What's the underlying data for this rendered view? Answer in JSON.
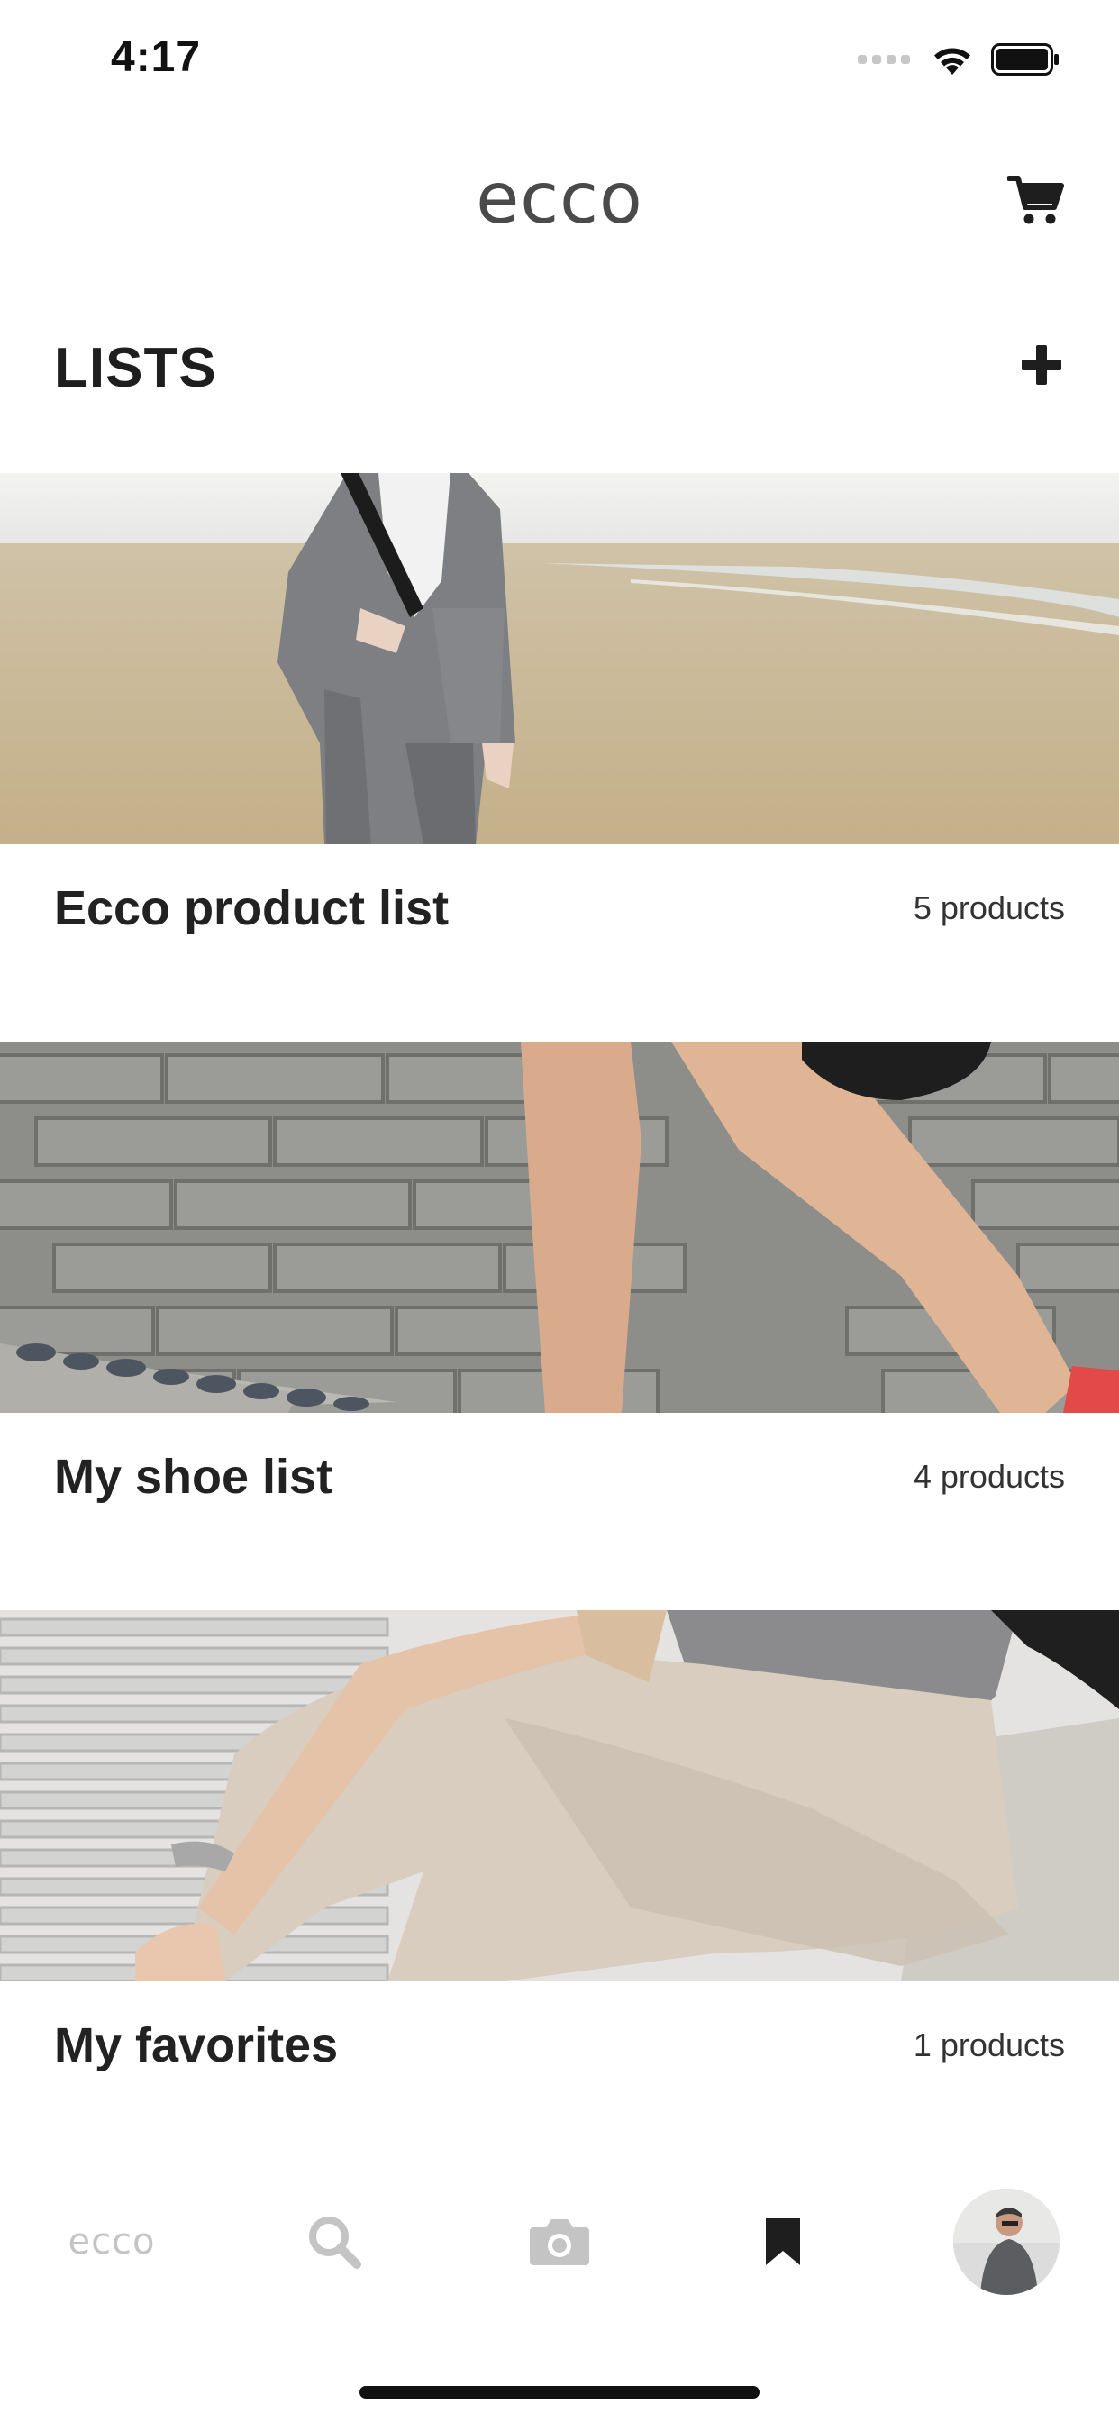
{
  "status": {
    "time": "4:17"
  },
  "header": {
    "brand": "ecco"
  },
  "page": {
    "title": "LISTS"
  },
  "lists": [
    {
      "name": "Ecco product list",
      "count": "5 products"
    },
    {
      "name": "My shoe list",
      "count": "4 products"
    },
    {
      "name": "My favorites",
      "count": "1 products"
    }
  ],
  "tabbar": {
    "home_label": "ecco",
    "active_tab": "saved"
  },
  "icons": {
    "cart": "cart-icon",
    "add": "plus-icon",
    "search": "search-icon",
    "camera": "camera-icon",
    "saved": "bookmark-icon",
    "profile": "avatar"
  },
  "colors": {
    "text": "#222222",
    "inactive_tab": "#c4c4c4",
    "active_tab": "#1e1e1e",
    "background": "#ffffff"
  }
}
